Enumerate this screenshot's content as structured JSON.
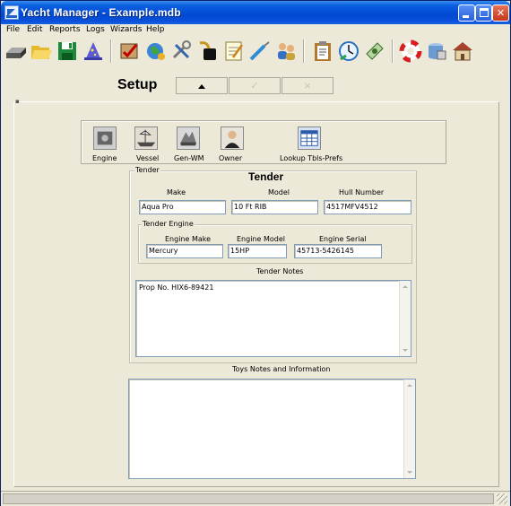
{
  "window": {
    "title": "Yacht Manager - Example.mdb"
  },
  "menu": {
    "items": [
      "File",
      "Edit",
      "Reports",
      "Logs",
      "Wizards",
      "Help"
    ]
  },
  "toolbar": {
    "icons": [
      "disk-drive-icon",
      "open-folder-icon",
      "save-icon",
      "wizard-hat-icon",
      "chart-check-icon",
      "globe-icon",
      "tools-icon",
      "key-icon",
      "notepad-icon",
      "pen-icon",
      "people-icon",
      "clipboard-icon",
      "clock-icon",
      "money-icon",
      "lifebuoy-icon",
      "database-icon",
      "house-icon"
    ]
  },
  "setup": {
    "title": "Setup",
    "nav_check": "✓",
    "nav_x": "×"
  },
  "sections": [
    {
      "label": "Engine",
      "icon": "engine-icon"
    },
    {
      "label": "Vessel",
      "icon": "vessel-icon"
    },
    {
      "label": "Gen-WM",
      "icon": "generator-icon"
    },
    {
      "label": "Owner",
      "icon": "owner-icon"
    },
    {
      "label": "Lookup Tbls-Prefs",
      "icon": "lookup-table-icon"
    }
  ],
  "tender": {
    "frame_label": "Tender",
    "heading": "Tender",
    "make_label": "Make",
    "make_value": "Aqua Pro",
    "model_label": "Model",
    "model_value": "10 Ft RIB",
    "hull_label": "Hull Number",
    "hull_value": "4517MFV4512",
    "engine_frame_label": "Tender Engine",
    "engine_make_label": "Engine Make",
    "engine_make_value": "Mercury",
    "engine_model_label": "Engine Model",
    "engine_model_value": "15HP",
    "engine_serial_label": "Engine Serial",
    "engine_serial_value": "45713-5426145",
    "notes_label": "Tender Notes",
    "notes_value": "Prop No. HIX6-89421"
  },
  "toys": {
    "label": "Toys Notes and Information",
    "value": ""
  }
}
